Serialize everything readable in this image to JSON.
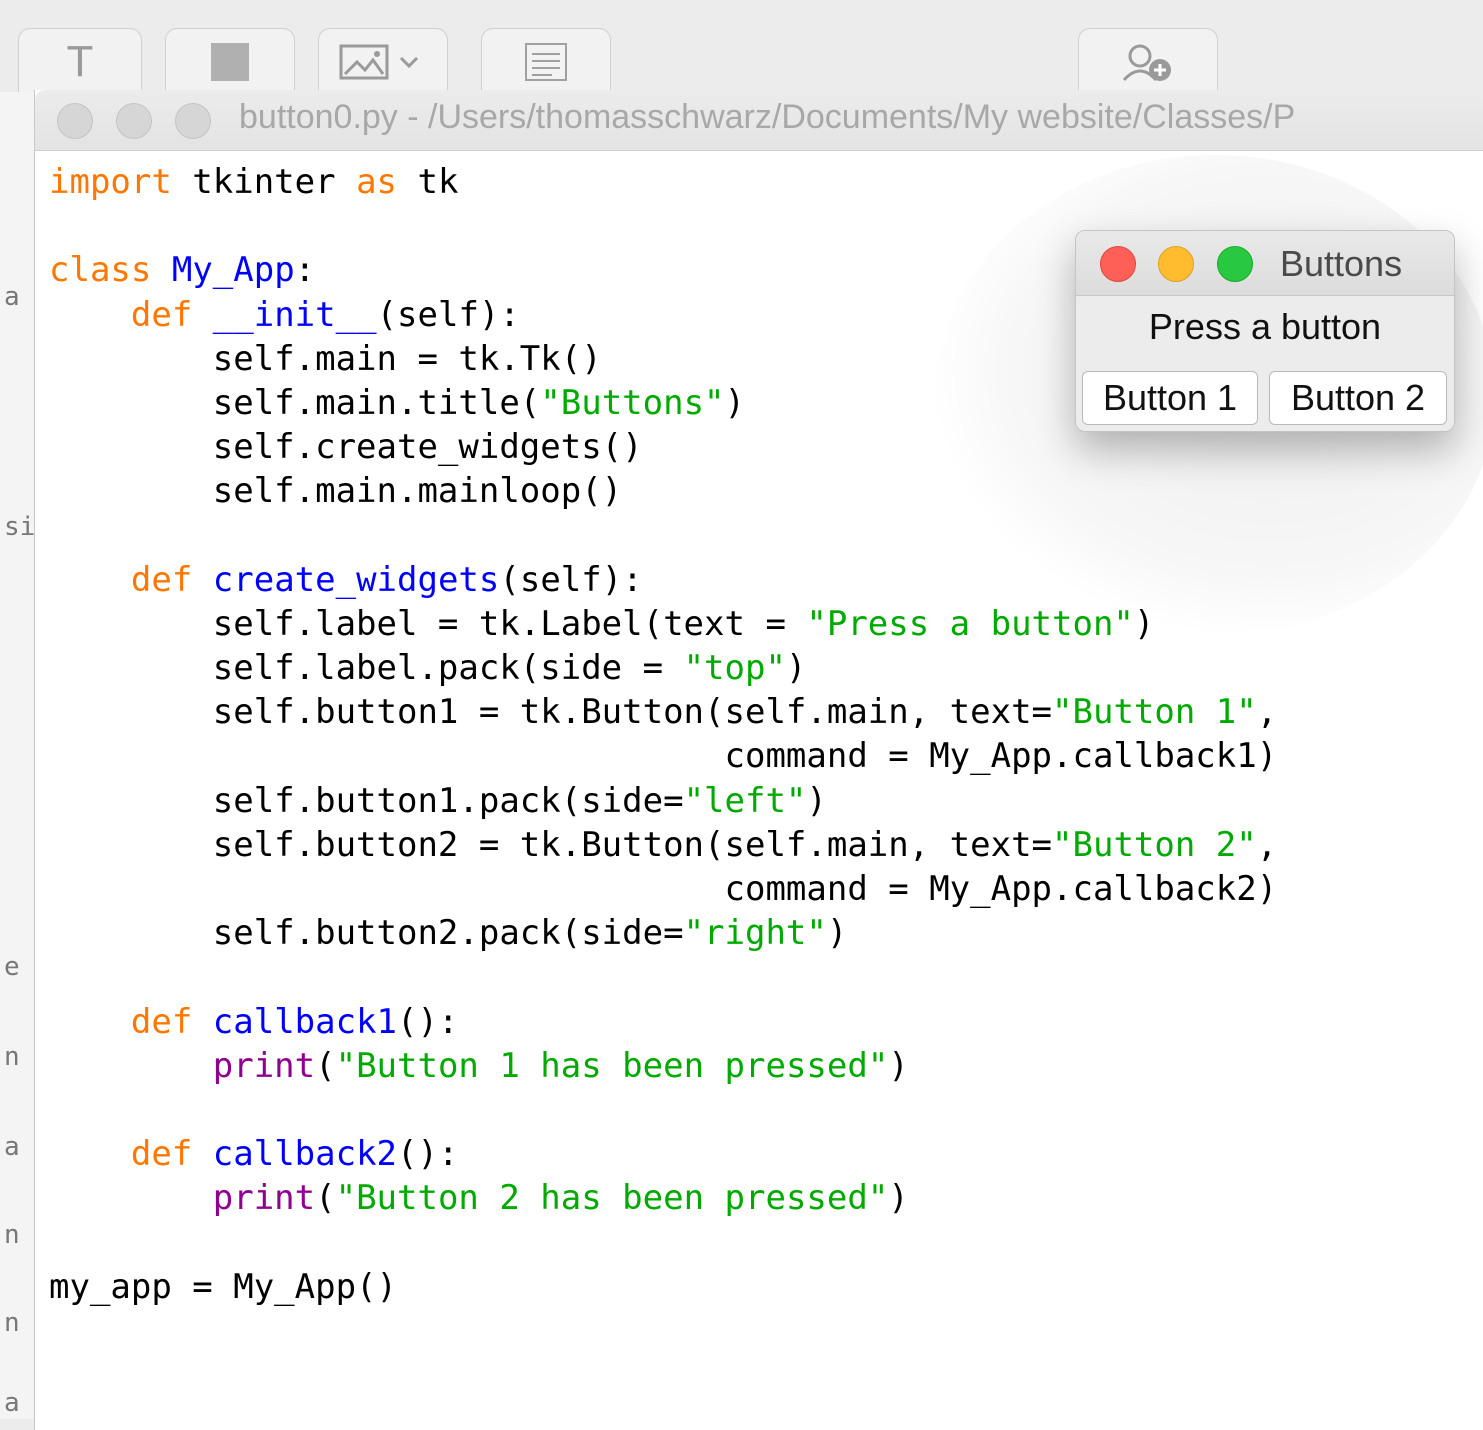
{
  "background_toolbar": {
    "tools": [
      "text-tool-icon",
      "shape-tool-icon",
      "image-tool-icon",
      "list-tool-icon",
      "collaborate-icon"
    ],
    "text_tool_glyph": "T"
  },
  "background_left_fragments": [
    "a",
    "si",
    "e",
    "n",
    "a",
    "n",
    "n",
    "a"
  ],
  "editor": {
    "title": "button0.py - /Users/thomasschwarz/Documents/My website/Classes/P"
  },
  "code_lines": [
    "import tkinter as tk",
    "",
    "class My_App:",
    "    def __init__(self):",
    "        self.main = tk.Tk()",
    "        self.main.title(\"Buttons\")",
    "        self.create_widgets()",
    "        self.main.mainloop()",
    "",
    "    def create_widgets(self):",
    "        self.label = tk.Label(text = \"Press a button\")",
    "        self.label.pack(side = \"top\")",
    "        self.button1 = tk.Button(self.main, text=\"Button 1\",",
    "                                 command = My_App.callback1)",
    "        self.button1.pack(side=\"left\")",
    "        self.button2 = tk.Button(self.main, text=\"Button 2\",",
    "                                 command = My_App.callback2)",
    "        self.button2.pack(side=\"right\")",
    "",
    "    def callback1():",
    "        print(\"Button 1 has been pressed\")",
    "",
    "    def callback2():",
    "        print(\"Button 2 has been pressed\")",
    "",
    "my_app = My_App()"
  ],
  "tk_window": {
    "title": "Buttons",
    "label": "Press a button",
    "button1": "Button 1",
    "button2": "Button 2"
  },
  "colors": {
    "keyword": "#ff7700",
    "definition": "#0000ff",
    "string": "#00aa00",
    "builtin": "#900090",
    "close": "#fe5f57",
    "minimize": "#febc2e",
    "zoom": "#28c840"
  }
}
